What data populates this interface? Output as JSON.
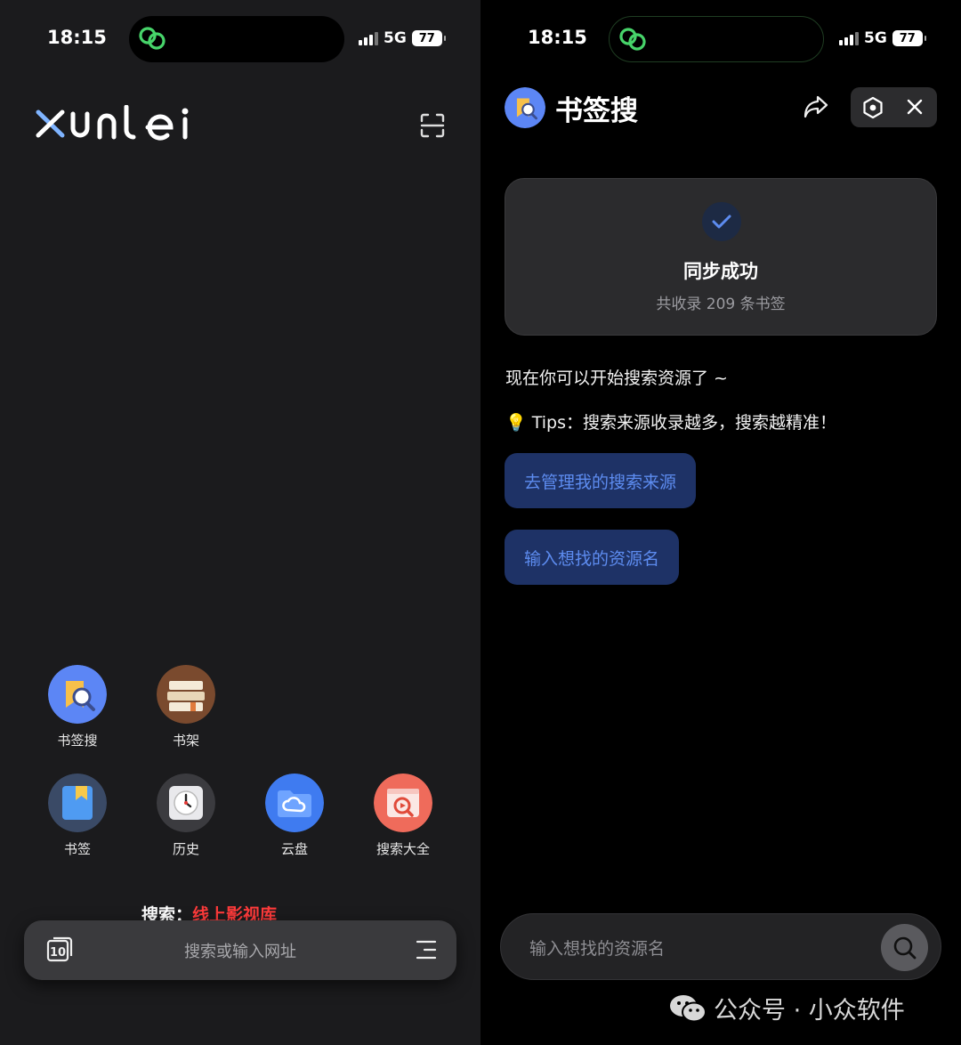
{
  "status_bar": {
    "time": "18:15",
    "network": "5G",
    "battery": "77"
  },
  "left_screen": {
    "logo_text": "xunlei",
    "apps": [
      {
        "label": "书签搜",
        "icon": "bookmark-search-icon"
      },
      {
        "label": "书架",
        "icon": "bookshelf-icon"
      },
      {
        "label": "书签",
        "icon": "bookmark-icon"
      },
      {
        "label": "历史",
        "icon": "history-clock-icon"
      },
      {
        "label": "云盘",
        "icon": "cloud-drive-icon"
      },
      {
        "label": "搜索大全",
        "icon": "search-all-icon"
      }
    ],
    "search_hint_key": "搜索：",
    "search_hint_value": "线上影视库",
    "search_placeholder": "搜索或输入网址",
    "tab_count": "10"
  },
  "right_screen": {
    "title": "书签搜",
    "sync_card": {
      "title": "同步成功",
      "subtitle": "共收录 209 条书签"
    },
    "message": "现在你可以开始搜索资源了 ~",
    "tips": "Tips：搜索来源收录越多，搜索越精准！",
    "tips_emoji": "💡",
    "buttons": {
      "manage_sources": "去管理我的搜索来源",
      "enter_resource": "输入想找的资源名"
    },
    "input_placeholder": "输入想找的资源名"
  },
  "watermark": {
    "text": "公众号 · 小众软件"
  },
  "colors": {
    "accent_blue": "#5d8cf0",
    "chip_bg": "#1e3266",
    "hint_red": "#ff3b3b",
    "island_green": "#47d46a"
  }
}
